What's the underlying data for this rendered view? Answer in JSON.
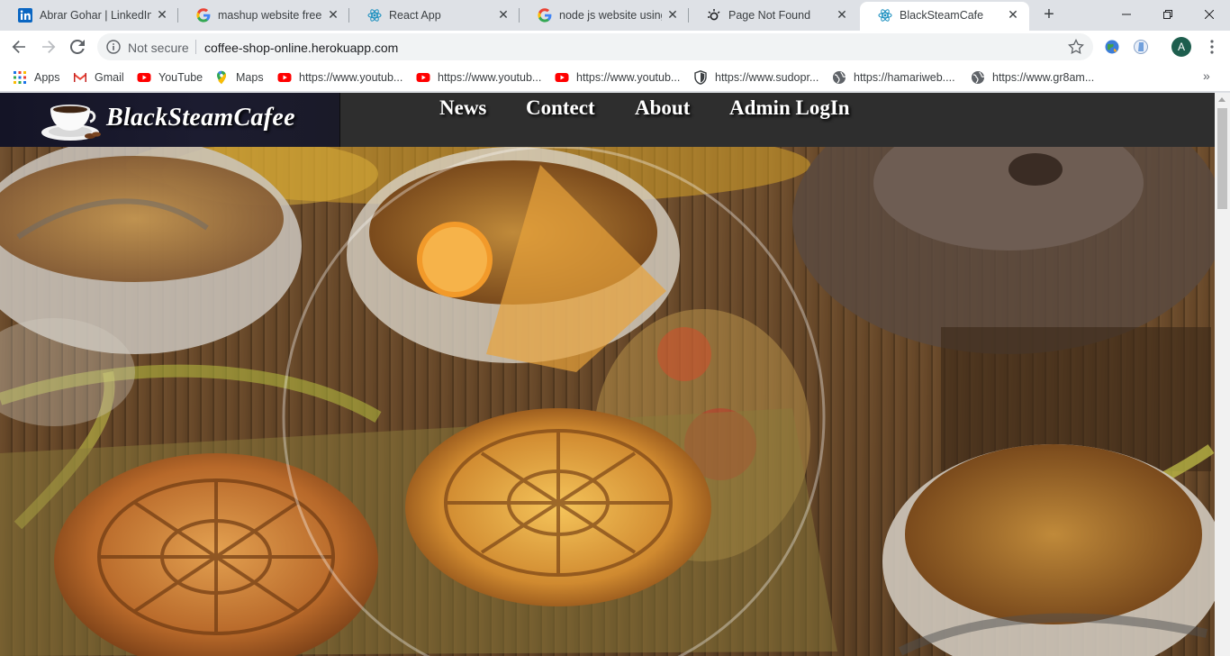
{
  "browser": {
    "tabs": [
      {
        "title": "Abrar Gohar | LinkedIn",
        "icon": "linkedin-icon"
      },
      {
        "title": "mashup website free - G",
        "icon": "google-icon"
      },
      {
        "title": "React App",
        "icon": "react-icon"
      },
      {
        "title": "node js website using h",
        "icon": "google-icon"
      },
      {
        "title": "Page Not Found",
        "icon": "gear-sun-icon"
      },
      {
        "title": "BlackSteamCafe",
        "icon": "react-icon",
        "active": true
      }
    ],
    "new_tab_label": "+",
    "window_controls": {
      "minimize": "—",
      "restore": "❐",
      "close": "✕"
    },
    "omnibox": {
      "security_label": "Not secure",
      "url": "coffee-shop-online.herokuapp.com"
    },
    "profile_initial": "A",
    "bookmarks": [
      {
        "label": "Apps",
        "icon": "apps-grid-icon"
      },
      {
        "label": "Gmail",
        "icon": "gmail-icon"
      },
      {
        "label": "YouTube",
        "icon": "youtube-icon"
      },
      {
        "label": "Maps",
        "icon": "maps-pin-icon"
      },
      {
        "label": "https://www.youtub...",
        "icon": "youtube-icon"
      },
      {
        "label": "https://www.youtub...",
        "icon": "youtube-icon"
      },
      {
        "label": "https://www.youtub...",
        "icon": "youtube-icon"
      },
      {
        "label": "https://www.sudopr...",
        "icon": "shield-icon"
      },
      {
        "label": "https://hamariweb....",
        "icon": "globe-icon"
      },
      {
        "label": "https://www.gr8am...",
        "icon": "globe-icon"
      }
    ],
    "bookmarks_overflow": "»"
  },
  "site": {
    "brand": {
      "part1": "Black",
      "part2": "Steam",
      "part3": "Cafee"
    },
    "nav": [
      "News",
      "Contect",
      "About",
      "Admin LogIn"
    ]
  },
  "colors": {
    "header_bg": "#2e2e2e",
    "brand_bg": "#1c1c30",
    "chrome_tabstrip": "#dee1e6"
  }
}
